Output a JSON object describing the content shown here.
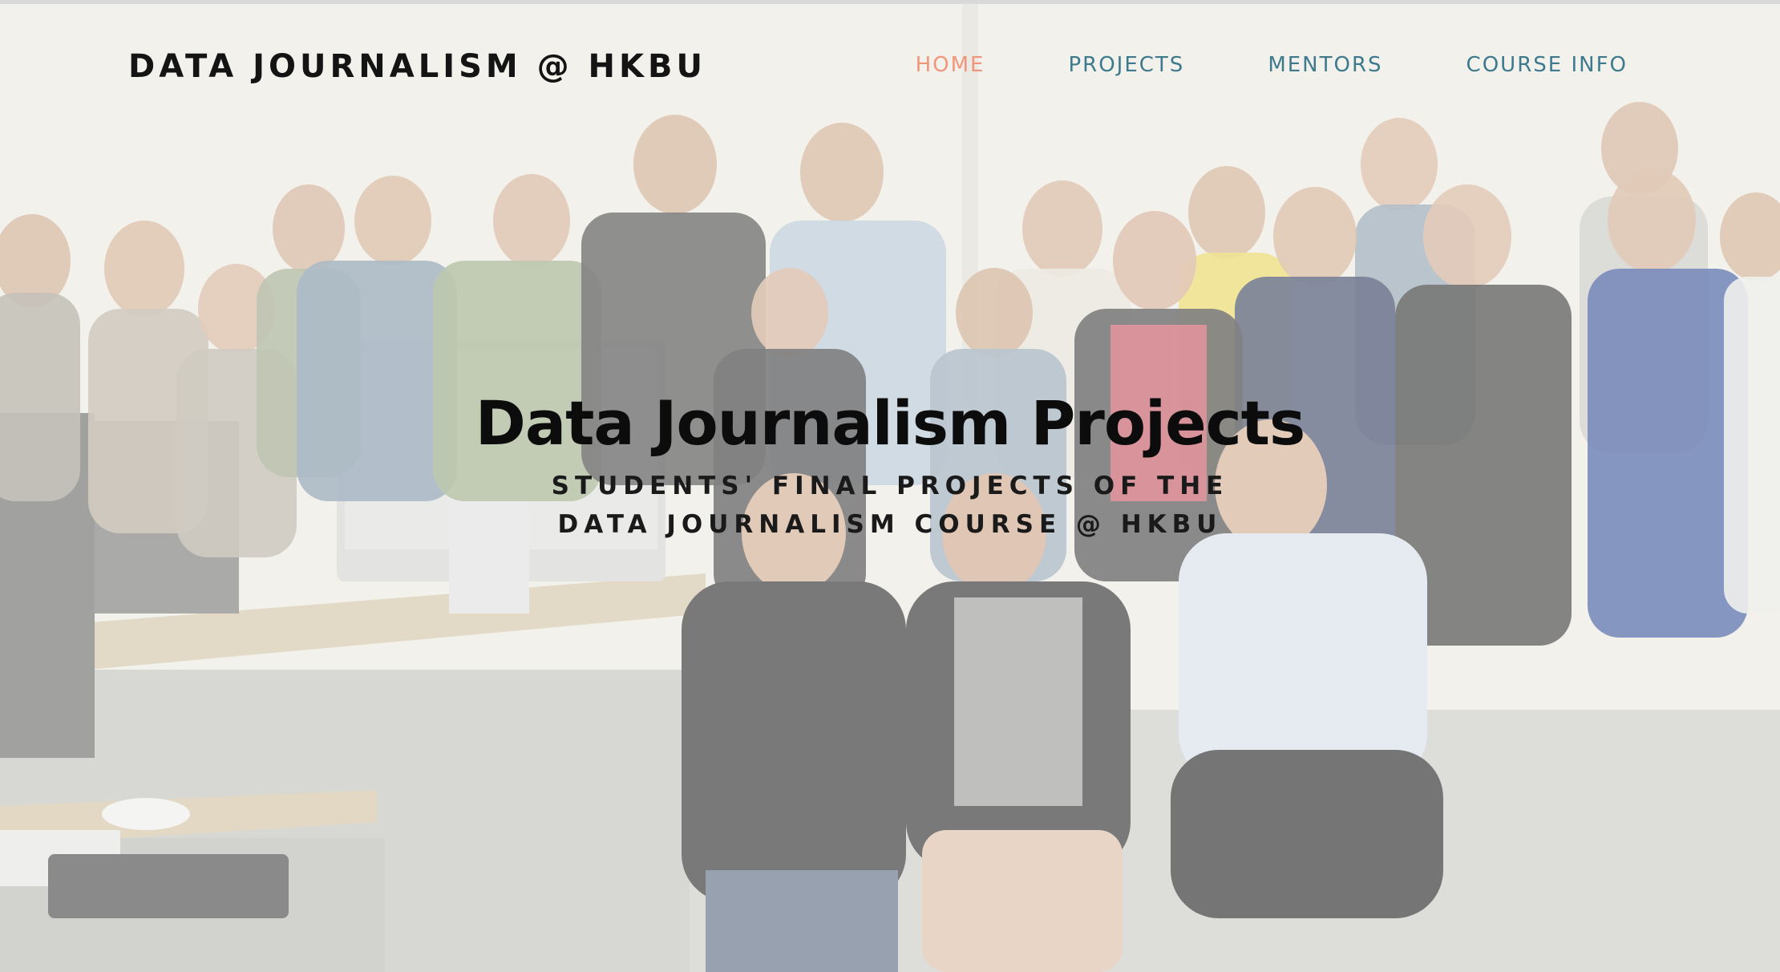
{
  "nav": {
    "brand": "DATA JOURNALISM @ HKBU",
    "links": [
      {
        "label": "HOME",
        "active": true
      },
      {
        "label": "PROJECTS",
        "active": false
      },
      {
        "label": "MENTORS",
        "active": false
      },
      {
        "label": "COURSE INFO",
        "active": false
      }
    ]
  },
  "hero": {
    "title": "Data Journalism Projects",
    "subtitle": "STUDENTS' FINAL PROJECTS OF THE DATA JOURNALISM COURSE @ HKBU",
    "background": "class group photo in a computer lab"
  },
  "colors": {
    "nav_link": "#3d7a8e",
    "nav_active": "#f0957a",
    "brand": "#141414",
    "title": "#0c0c0c"
  }
}
